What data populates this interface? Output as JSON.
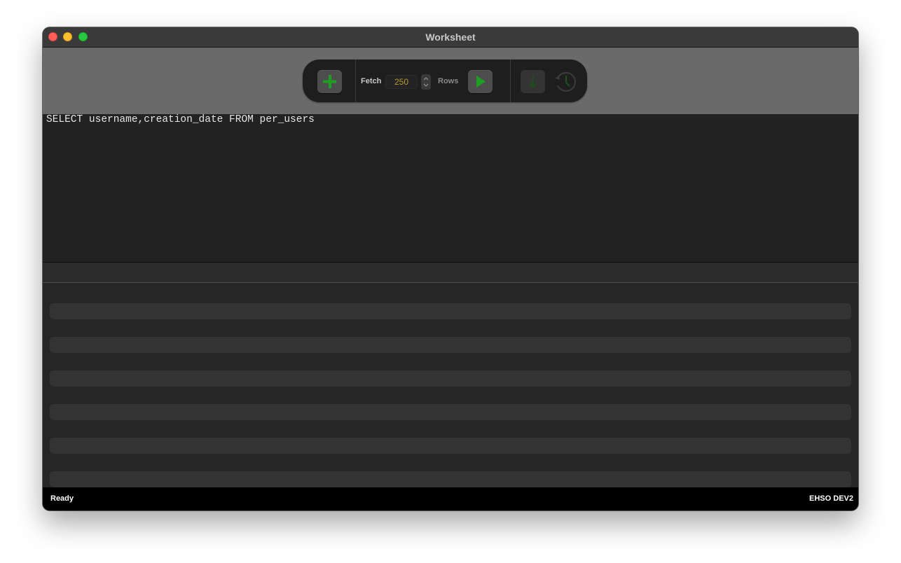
{
  "window": {
    "title": "Worksheet"
  },
  "toolbar": {
    "add_icon": "plus-icon",
    "fetch_label": "Fetch",
    "fetch_value": "250",
    "rows_label": "Rows",
    "run_icon": "play-icon",
    "export_icon": "download-arrow-icon",
    "history_icon": "history-clock-icon"
  },
  "editor": {
    "sql": "SELECT username,creation_date FROM per_users"
  },
  "statusbar": {
    "status": "Ready",
    "connection": "EHSO DEV2"
  },
  "colors": {
    "accent_green": "#1f9e23",
    "fetch_value": "#b89a2c",
    "close": "#fe5f57",
    "minimize": "#febc2e",
    "zoom": "#28c840"
  }
}
